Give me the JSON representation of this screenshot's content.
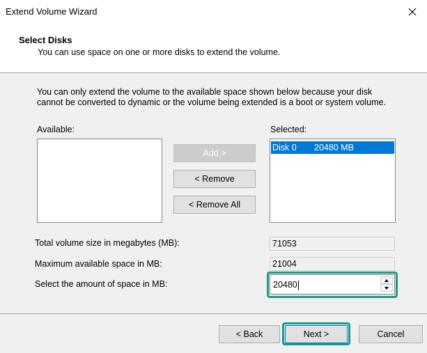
{
  "window": {
    "title": "Extend Volume Wizard"
  },
  "header": {
    "title": "Select Disks",
    "subtitle": "You can use space on one or more disks to extend the volume."
  },
  "main": {
    "description": "You can only extend the volume to the available space shown below because your disk cannot be converted to dynamic or the volume being extended is a boot or system volume.",
    "available_label": "Available:",
    "selected_label": "Selected:",
    "selected_items": [
      {
        "disk": "Disk 0",
        "size": "20480 MB"
      }
    ],
    "add_label": "Add >",
    "remove_label": "< Remove",
    "remove_all_label": "< Remove All",
    "total_label": "Total volume size in megabytes (MB):",
    "total_value": "71053",
    "max_label": "Maximum available space in MB:",
    "max_value": "21004",
    "amount_label": "Select the amount of space in MB:",
    "amount_value": "20480"
  },
  "footer": {
    "back_label": "< Back",
    "next_label": "Next >",
    "cancel_label": "Cancel"
  },
  "colors": {
    "selection": "#0078d7",
    "focus_highlight": "#1b9a8a",
    "dialog_bg": "#f0f0f0"
  }
}
